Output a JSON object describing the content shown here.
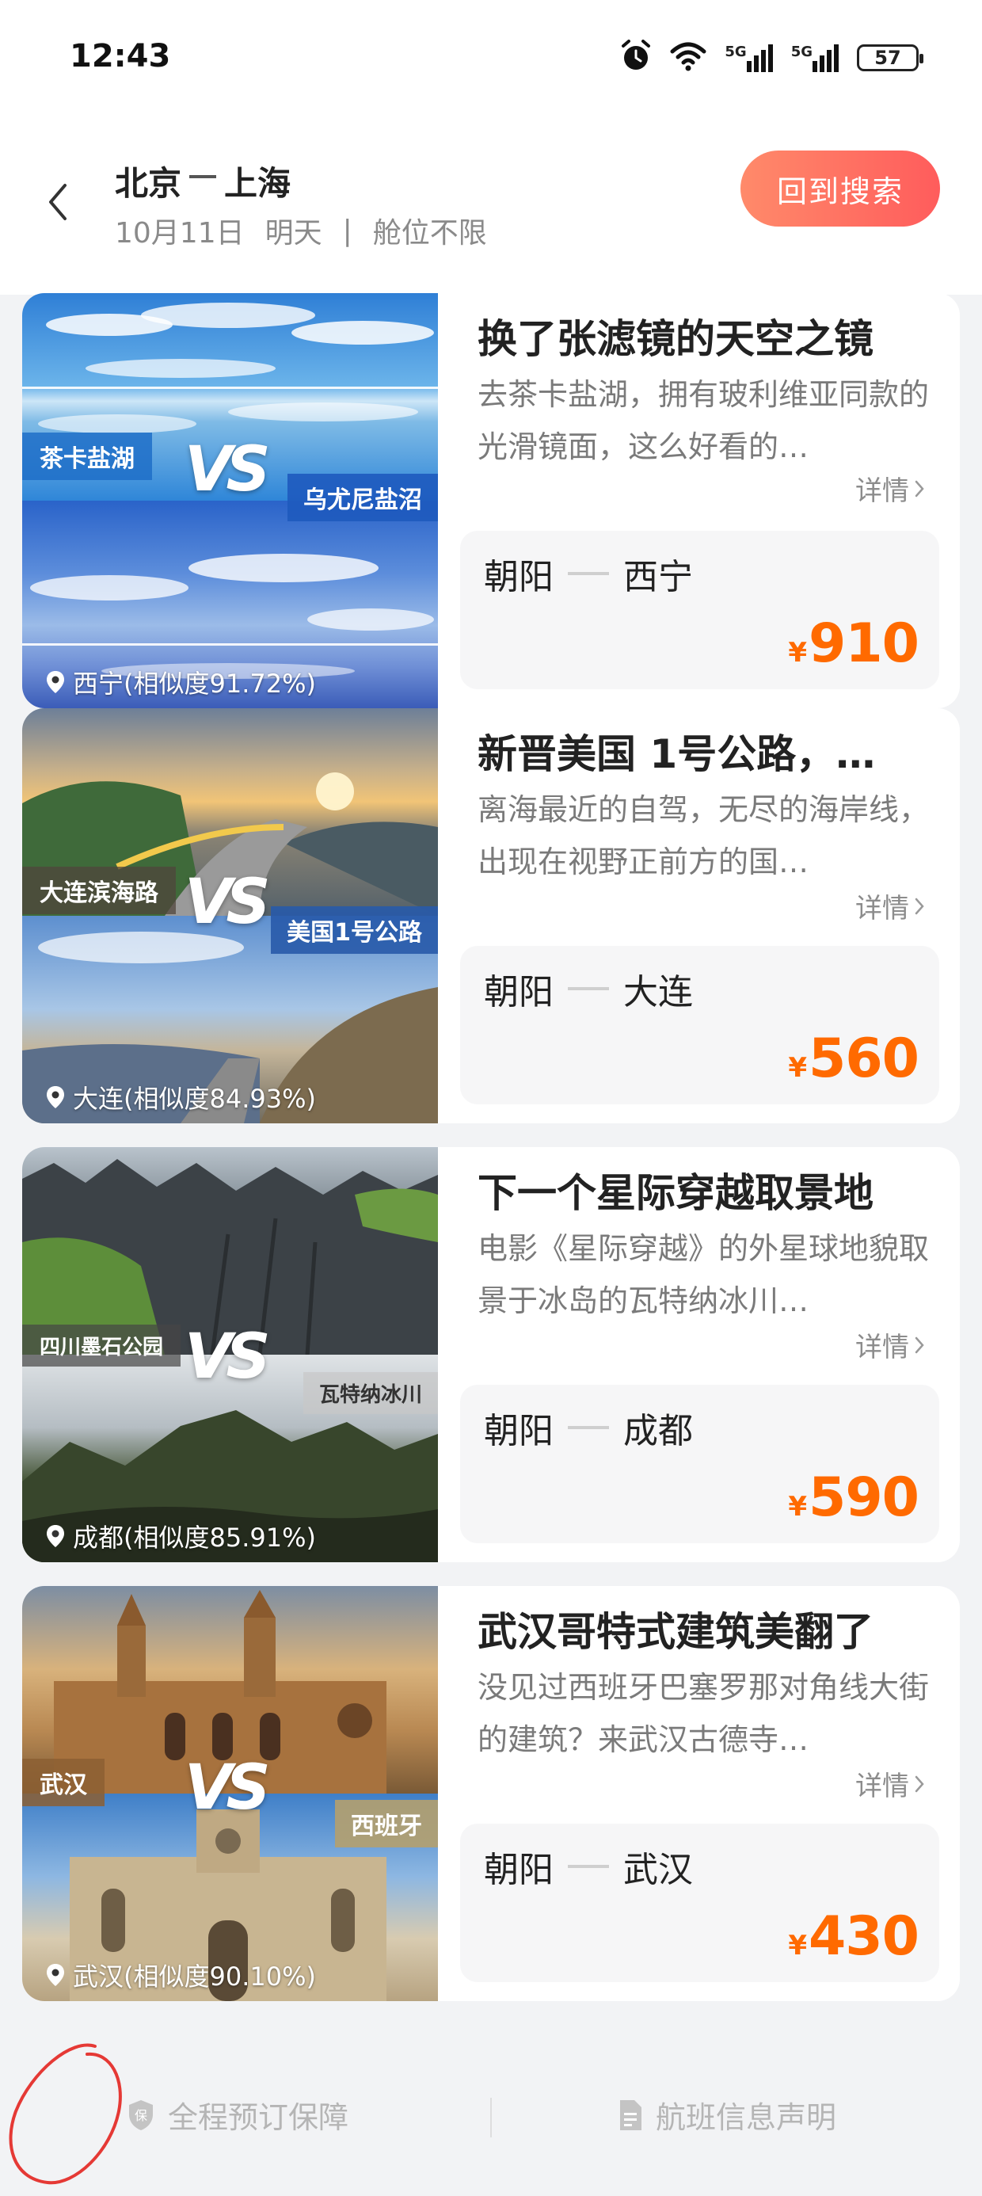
{
  "status_bar": {
    "time": "12:43",
    "signal1_label": "5G",
    "signal2_label": "5G",
    "battery": "57"
  },
  "header": {
    "origin": "北京",
    "destination": "上海",
    "date": "10月11日",
    "day": "明天",
    "divider": "|",
    "cabin": "舱位不限",
    "back_to_search": "回到搜索"
  },
  "cards": [
    {
      "left_tag": "茶卡盐湖",
      "right_tag": "乌尤尼盐沼",
      "similarity": "西宁(相似度91.72%)",
      "title": "换了张滤镜的天空之镜",
      "desc": "去茶卡盐湖，拥有玻利维亚同款的光滑镜面，这么好看的…",
      "detail": "详情",
      "from": "朝阳",
      "to": "西宁",
      "currency": "¥",
      "price": "910"
    },
    {
      "left_tag": "大连滨海路",
      "right_tag": "美国1号公路",
      "similarity": "大连(相似度84.93%)",
      "title": "新晋美国 1号公路，…",
      "desc": "离海最近的自驾，无尽的海岸线，出现在视野正前方的国…",
      "detail": "详情",
      "from": "朝阳",
      "to": "大连",
      "currency": "¥",
      "price": "560"
    },
    {
      "left_tag": "四川墨石公园",
      "right_tag": "瓦特纳冰川",
      "similarity": "成都(相似度85.91%)",
      "title": "下一个星际穿越取景地",
      "desc": "电影《星际穿越》的外星球地貌取景于冰岛的瓦特纳冰川…",
      "detail": "详情",
      "from": "朝阳",
      "to": "成都",
      "currency": "¥",
      "price": "590"
    },
    {
      "left_tag": "武汉",
      "right_tag": "西班牙",
      "similarity": "武汉(相似度90.10%)",
      "title": "武汉哥特式建筑美翻了",
      "desc": "没见过西班牙巴塞罗那对角线大街的建筑？来武汉古德寺…",
      "detail": "详情",
      "from": "朝阳",
      "to": "武汉",
      "currency": "¥",
      "price": "430"
    }
  ],
  "footer": {
    "guarantee_icon_text": "保",
    "guarantee": "全程预订保障",
    "flight_info": "航班信息声明"
  },
  "colors": {
    "price": "#ff6a00",
    "button_gradient_start": "#ff8a6a",
    "button_gradient_end": "#ff5c5c"
  }
}
